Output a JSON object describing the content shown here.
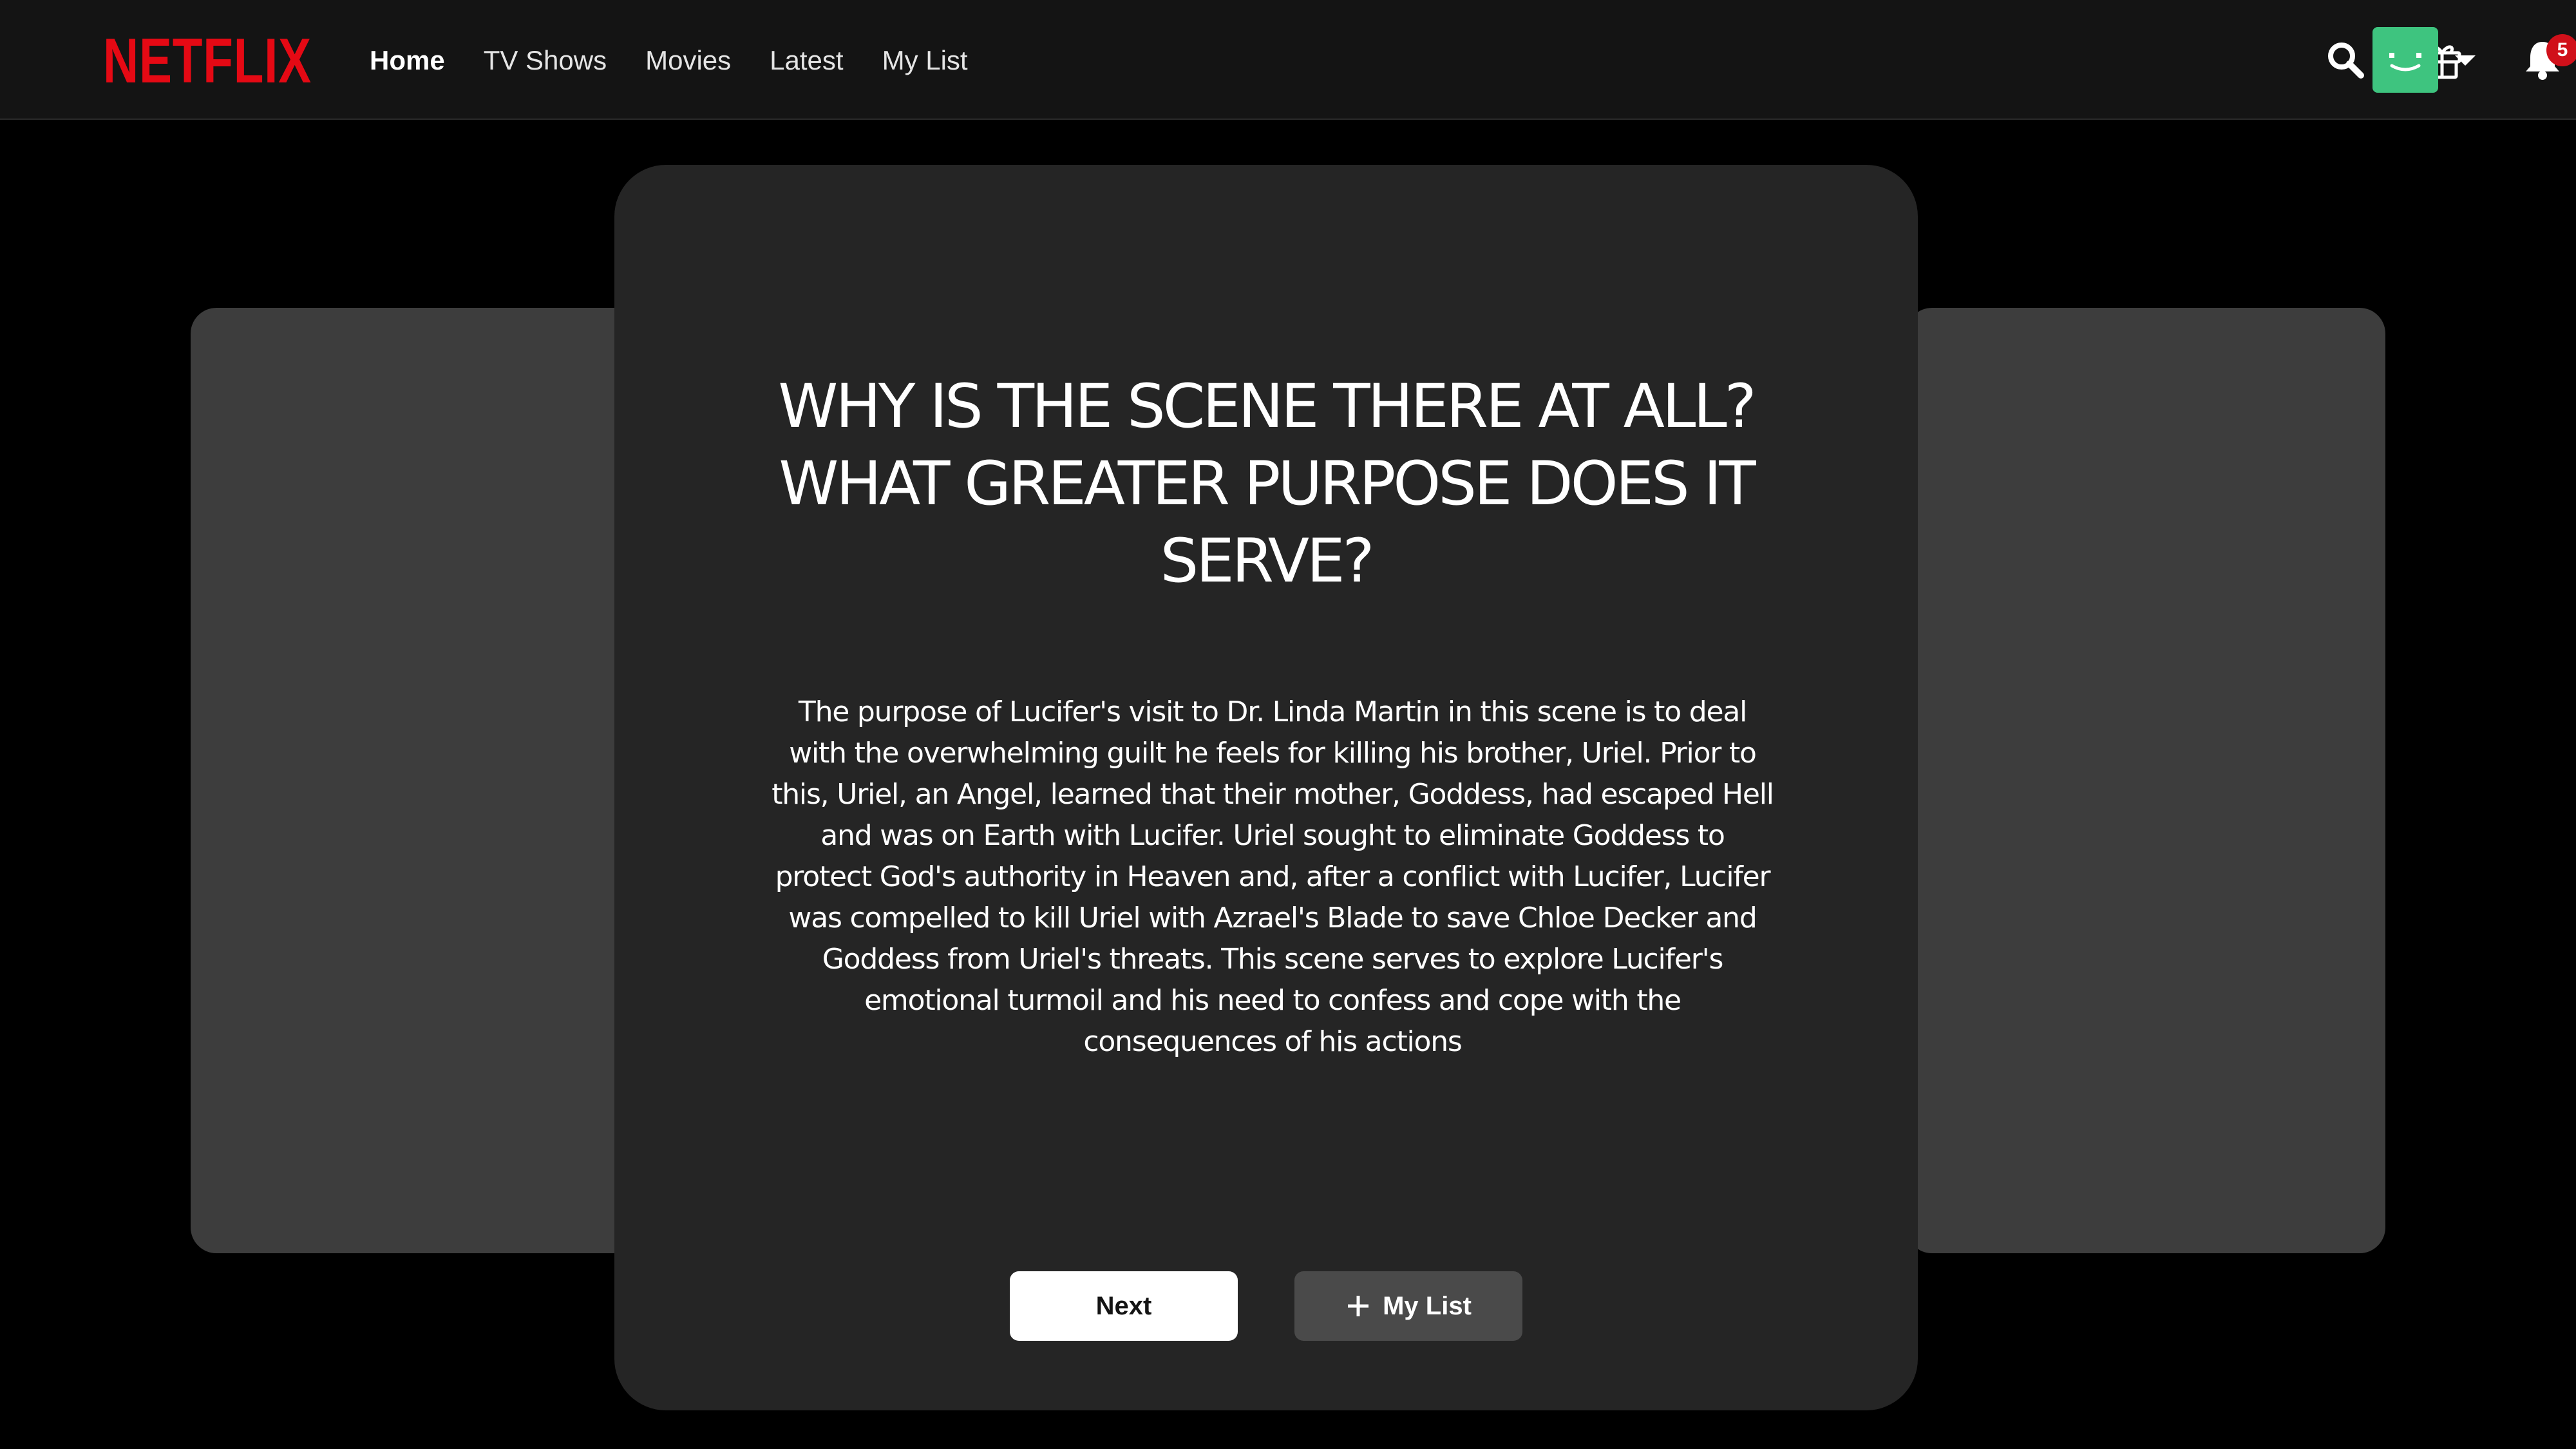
{
  "brand": {
    "logo_text": "NETFLIX",
    "color": "#e50914"
  },
  "nav": {
    "links": [
      {
        "label": "Home",
        "active": true
      },
      {
        "label": "TV Shows",
        "active": false
      },
      {
        "label": "Movies",
        "active": false
      },
      {
        "label": "Latest",
        "active": false
      },
      {
        "label": "My List",
        "active": false
      }
    ]
  },
  "header_actions": {
    "search_icon": "search-icon",
    "gift_icon": "gift-icon",
    "notifications_icon": "bell-icon",
    "notification_count": "5",
    "avatar_color": "#3ec47f"
  },
  "card": {
    "title": "WHY IS THE SCENE THERE AT ALL? WHAT GREATER PURPOSE DOES IT SERVE?",
    "body": "The purpose of Lucifer's visit to Dr. Linda Martin in this scene is to deal with the overwhelming guilt he feels for killing his brother, Uriel. Prior to this, Uriel, an Angel, learned that their mother, Goddess, had escaped Hell and was on Earth with Lucifer. Uriel sought to eliminate Goddess to protect God's authority in Heaven and, after a conflict with Lucifer, Lucifer was compelled to kill Uriel with Azrael's Blade to save Chloe Decker and Goddess from Uriel's threats. This scene serves to explore Lucifer's emotional turmoil and his need to confess and cope with the consequences of his actions",
    "next_label": "Next",
    "mylist_label": "My List"
  }
}
